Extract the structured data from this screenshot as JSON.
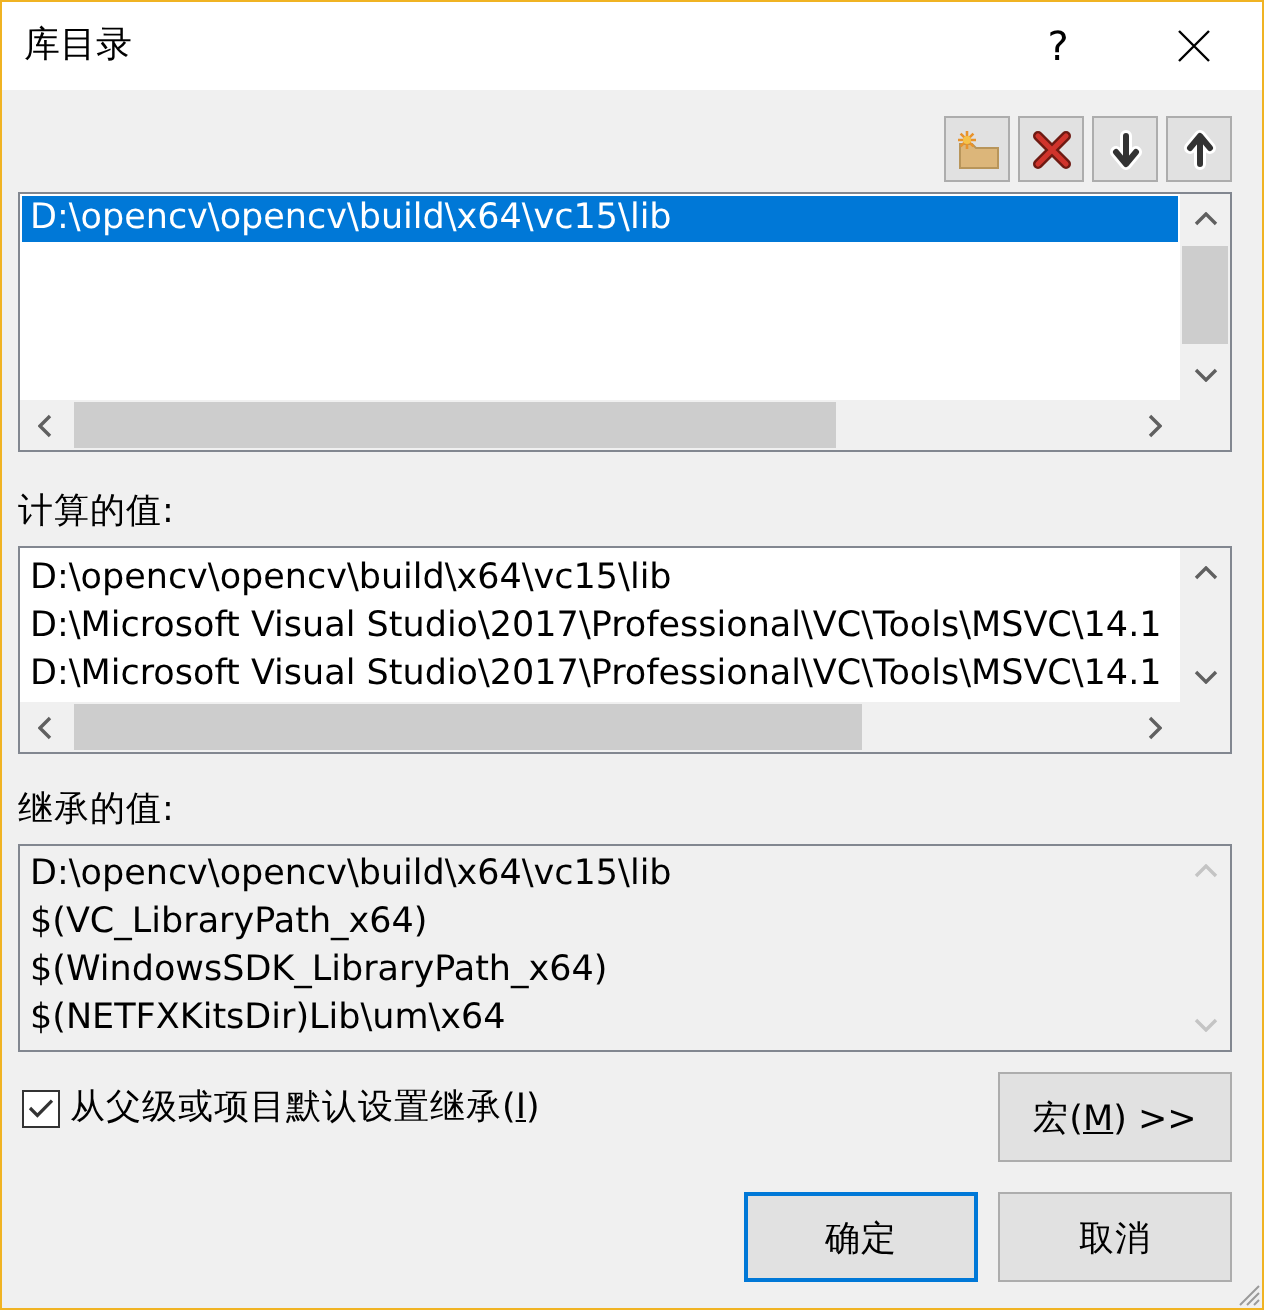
{
  "window": {
    "title": "库目录",
    "help_button": "?"
  },
  "directory_list": {
    "disabled": false,
    "items": [
      {
        "text": "D:\\opencv\\opencv\\build\\x64\\vc15\\lib",
        "selected": true
      }
    ]
  },
  "computed_values": {
    "label": "计算的值:",
    "disabled": false,
    "items": [
      "D:\\opencv\\opencv\\build\\x64\\vc15\\lib",
      "D:\\Microsoft Visual Studio\\2017\\Professional\\VC\\Tools\\MSVC\\14.1",
      "D:\\Microsoft Visual Studio\\2017\\Professional\\VC\\Tools\\MSVC\\14.1"
    ]
  },
  "inherited_values": {
    "label": "继承的值:",
    "disabled": true,
    "items": [
      "D:\\opencv\\opencv\\build\\x64\\vc15\\lib",
      "$(VC_LibraryPath_x64)",
      "$(WindowsSDK_LibraryPath_x64)",
      "$(NETFXKitsDir)Lib\\um\\x64"
    ]
  },
  "inherit_checkbox": {
    "label": "从父级或项目默认设置继承(",
    "access_key": "I",
    "label_after": ")",
    "checked": true
  },
  "buttons": [
    {
      "label": "宏(",
      "access_key": "M",
      "label_after": ") >>",
      "default": false
    },
    {
      "label": "确定",
      "default": true
    },
    {
      "label": "取消",
      "default": false
    }
  ]
}
